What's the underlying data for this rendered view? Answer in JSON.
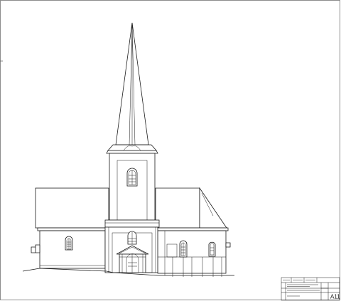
{
  "drawing": {
    "subject": "church-elevation",
    "line_color": "#1a1a1a",
    "background": "#ffffff"
  },
  "title_block": {
    "sheet_number": "A11",
    "icons": [
      "revision-table",
      "project-title",
      "drawing-title"
    ]
  }
}
